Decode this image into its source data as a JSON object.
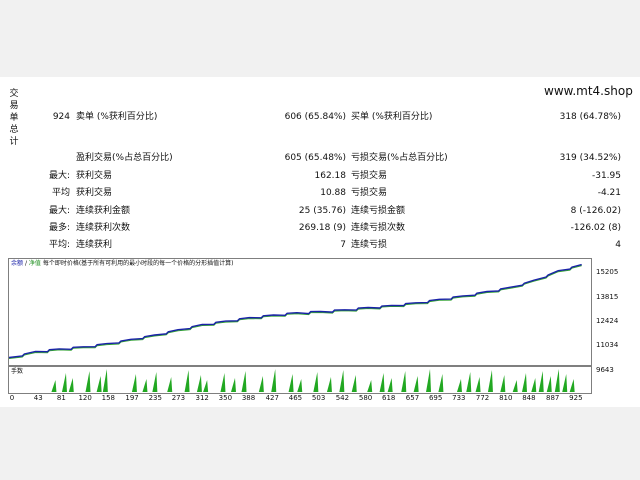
{
  "side_label": "交易单总计",
  "site": "www.mt4.shop",
  "stats": {
    "total_trades": "924",
    "sell_label": "卖单 (%获利百分比)",
    "sell_value": "606 (65.84%)",
    "buy_label": "买单 (%获利百分比)",
    "buy_value": "318 (64.78%)",
    "profit_trades_label": "盈利交易(%占总百分比)",
    "profit_trades_value": "605 (65.48%)",
    "loss_trades_label": "亏损交易(%占总百分比)",
    "loss_trades_value": "319 (34.52%)",
    "max_label": "最大:",
    "max_profit_label": "获利交易",
    "max_profit_value": "162.18",
    "max_loss_label": "亏损交易",
    "max_loss_value": "-31.95",
    "avg_label": "平均",
    "avg_profit_label": "获利交易",
    "avg_profit_value": "10.88",
    "avg_loss_label": "亏损交易",
    "avg_loss_value": "-4.21",
    "max2_label": "最大:",
    "cons_win_money_label": "连续获利金额",
    "cons_win_money_value": "25 (35.76)",
    "cons_loss_money_label": "连续亏损金额",
    "cons_loss_money_value": "8 (-126.02)",
    "most_label": "最多:",
    "cons_win_count_label": "连续获利次数",
    "cons_win_count_value": "269.18 (9)",
    "cons_loss_count_label": "连续亏损次数",
    "cons_loss_count_value": "-126.02 (8)",
    "avg2_label": "平均:",
    "cons_win_label": "连续获利",
    "cons_win_value": "7",
    "cons_loss_label": "连续亏损",
    "cons_loss_value": "4"
  },
  "chart_legend": {
    "balance": "余额",
    "equity": "净值",
    "note": "每个即时价格(基于所有可利用的最小时段的每一个价格的分形插值计算)"
  },
  "volume_label": "手数",
  "chart_data": {
    "type": "line",
    "x": [
      0,
      43,
      81,
      120,
      158,
      197,
      235,
      273,
      312,
      350,
      388,
      427,
      465,
      503,
      542,
      580,
      618,
      657,
      695,
      733,
      772,
      810,
      848,
      887,
      925
    ],
    "x_tick_labels": [
      "0",
      "43",
      "81",
      "120",
      "158",
      "197",
      "235",
      "273",
      "312",
      "350",
      "388",
      "427",
      "465",
      "503",
      "542",
      "580",
      "618",
      "657",
      "695",
      "733",
      "772",
      "810",
      "848",
      "887",
      "925"
    ],
    "y_tick_labels": [
      "15205",
      "13815",
      "12424",
      "11034",
      "9643"
    ],
    "ylim": [
      9643,
      15400
    ],
    "series": [
      {
        "color": "#1a22a8",
        "values": [
          9900,
          10250,
          10400,
          10520,
          10700,
          10950,
          11200,
          11500,
          11800,
          12000,
          12200,
          12350,
          12480,
          12550,
          12650,
          12780,
          12900,
          13050,
          13250,
          13450,
          13700,
          13950,
          14350,
          14900,
          15250
        ]
      }
    ],
    "volume_spikes": [
      75,
      92,
      103,
      130,
      148,
      158,
      205,
      222,
      238,
      262,
      290,
      310,
      320,
      348,
      365,
      382,
      410,
      430,
      458,
      472,
      498,
      520,
      540,
      560,
      585,
      605,
      618,
      640,
      660,
      680,
      700,
      730,
      745,
      760,
      780,
      800,
      820,
      835,
      850,
      862,
      875,
      888,
      900,
      912
    ]
  }
}
